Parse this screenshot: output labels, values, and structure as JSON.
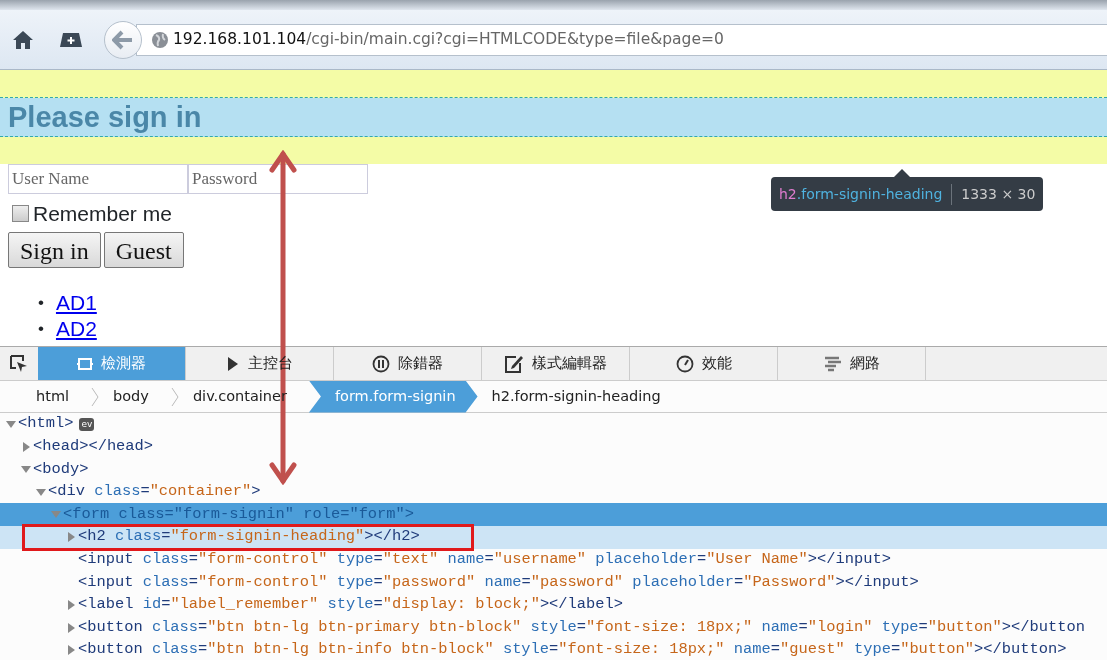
{
  "browser": {
    "url_host": "192.168.101.104",
    "url_path": "/cgi-bin/main.cgi?cgi=HTMLCODE&type=file&page=0"
  },
  "page": {
    "heading": "Please sign in",
    "username_placeholder": "User Name",
    "password_placeholder": "Password",
    "remember": {
      "label": "Remember me",
      "checked": false
    },
    "buttons": [
      "Sign in",
      "Guest"
    ],
    "links": [
      {
        "bullet": "•",
        "label": "AD1"
      },
      {
        "bullet": "•",
        "label": "AD2"
      }
    ]
  },
  "tooltip": {
    "tag": "h2",
    "classes": ".form-signin-heading",
    "size": "1333 × 30"
  },
  "devtools": {
    "tabs": [
      {
        "kind": "inspector",
        "label": "檢測器",
        "selected": true
      },
      {
        "kind": "console",
        "label": "主控台",
        "selected": false
      },
      {
        "kind": "debugger",
        "label": "除錯器",
        "selected": false
      },
      {
        "kind": "style",
        "label": "樣式編輯器",
        "selected": false
      },
      {
        "kind": "performance",
        "label": "效能",
        "selected": false
      },
      {
        "kind": "network",
        "label": "網路",
        "selected": false
      }
    ],
    "breadcrumbs": [
      {
        "label": "html",
        "selected": false
      },
      {
        "label": "body",
        "selected": false
      },
      {
        "label": "div.container",
        "selected": false
      },
      {
        "label": "form.form-signin",
        "selected": true
      },
      {
        "label": "h2.form-signin-heading",
        "selected": false
      }
    ],
    "tree": [
      {
        "text": "<html>",
        "badge": "ev",
        "expandable": true,
        "expanded": true,
        "selected": false,
        "hovered": false,
        "children": [
          {
            "text": "<head></head>",
            "expandable": true,
            "expanded": false,
            "selected": false,
            "hovered": false
          },
          {
            "text": "<body>",
            "expandable": true,
            "expanded": true,
            "selected": false,
            "hovered": false,
            "children": [
              {
                "text": "<div class=\"container\">",
                "expandable": true,
                "expanded": true,
                "selected": false,
                "hovered": false,
                "children": [
                  {
                    "text": "<form class=\"form-signin\" role=\"form\">",
                    "expandable": true,
                    "expanded": true,
                    "selected": true,
                    "hovered": false,
                    "children": [
                      {
                        "text": "<h2 class=\"form-signin-heading\"></h2>",
                        "expandable": true,
                        "expanded": false,
                        "selected": false,
                        "hovered": true
                      },
                      {
                        "text": "<input class=\"form-control\" type=\"text\" name=\"username\" placeholder=\"User Name\"></input>",
                        "expandable": false,
                        "selected": false,
                        "hovered": false
                      },
                      {
                        "text": "<input class=\"form-control\" type=\"password\" name=\"password\" placeholder=\"Password\"></input>",
                        "expandable": false,
                        "selected": false,
                        "hovered": false
                      },
                      {
                        "text": "<label id=\"label_remember\" style=\"display: block;\"></label>",
                        "expandable": true,
                        "expanded": false,
                        "selected": false,
                        "hovered": false
                      },
                      {
                        "text": "<button class=\"btn btn-lg btn-primary btn-block\" style=\"font-size: 18px;\" name=\"login\" type=\"button\"></button",
                        "expandable": true,
                        "expanded": false,
                        "selected": false,
                        "hovered": false
                      },
                      {
                        "text": "<button class=\"btn btn-lg btn-info btn-block\" style=\"font-size: 18px;\" name=\"guest\" type=\"button\"></button>",
                        "expandable": true,
                        "expanded": false,
                        "selected": false,
                        "hovered": false
                      }
                    ]
                  }
                ]
              }
            ]
          }
        ]
      }
    ]
  }
}
